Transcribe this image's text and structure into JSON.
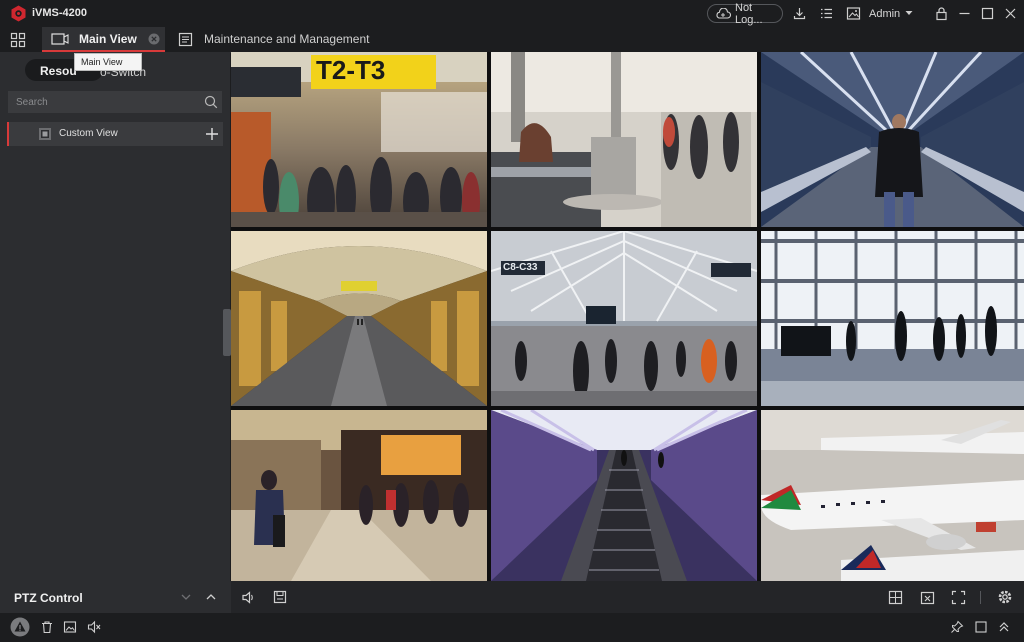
{
  "window": {
    "title": "iVMS-4200",
    "login_status": "Not Log...",
    "user": "Admin"
  },
  "tabs": {
    "main": "Main View",
    "maintenance": "Maintenance and Management"
  },
  "tooltip": "Main View",
  "sidebar": {
    "tab_resource": "Resou",
    "tab_autoswitch": "o-Switch",
    "search_placeholder": "Search",
    "custom_view": "Custom View"
  },
  "cameras": [
    {
      "signage": "T2-T3"
    },
    {},
    {},
    {},
    {
      "signage": "C8-C33"
    },
    {},
    {},
    {},
    {}
  ],
  "ptz": {
    "label": "PTZ Control"
  },
  "colors": {
    "accent": "#d83a3a",
    "panel": "#2c2d30",
    "titlebar": "#1c1d1f"
  }
}
